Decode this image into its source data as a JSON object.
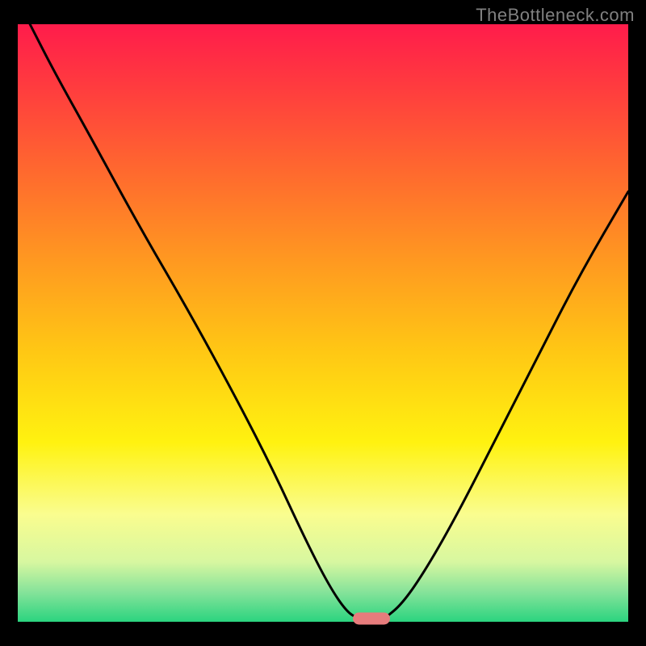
{
  "watermark": "TheBottleneck.com",
  "colors": {
    "bg": "#000000",
    "text_muted": "#808080",
    "curve": "#000000",
    "marker": "#e77c7c",
    "gradient_stops": [
      {
        "offset": 0.0,
        "color": "#ff1c4b"
      },
      {
        "offset": 0.1,
        "color": "#ff3a3f"
      },
      {
        "offset": 0.25,
        "color": "#ff6a2e"
      },
      {
        "offset": 0.4,
        "color": "#ff9a20"
      },
      {
        "offset": 0.55,
        "color": "#ffc814"
      },
      {
        "offset": 0.7,
        "color": "#fff210"
      },
      {
        "offset": 0.82,
        "color": "#fafd8f"
      },
      {
        "offset": 0.9,
        "color": "#d7f7a0"
      },
      {
        "offset": 0.95,
        "color": "#86e39a"
      },
      {
        "offset": 1.0,
        "color": "#2bd47f"
      }
    ]
  },
  "chart_data": {
    "type": "line",
    "title": "",
    "xlabel": "",
    "ylabel": "",
    "xlim": [
      0,
      100
    ],
    "ylim": [
      0,
      100
    ],
    "grid": false,
    "curve_left": [
      {
        "x": 2,
        "y": 100
      },
      {
        "x": 6,
        "y": 92
      },
      {
        "x": 12,
        "y": 81
      },
      {
        "x": 20,
        "y": 66
      },
      {
        "x": 28,
        "y": 52
      },
      {
        "x": 36,
        "y": 37
      },
      {
        "x": 42,
        "y": 25
      },
      {
        "x": 47,
        "y": 14
      },
      {
        "x": 51,
        "y": 6
      },
      {
        "x": 54,
        "y": 1.5
      },
      {
        "x": 56,
        "y": 0.5
      }
    ],
    "curve_right": [
      {
        "x": 60,
        "y": 0.5
      },
      {
        "x": 63,
        "y": 3
      },
      {
        "x": 67,
        "y": 9
      },
      {
        "x": 72,
        "y": 18
      },
      {
        "x": 78,
        "y": 30
      },
      {
        "x": 85,
        "y": 44
      },
      {
        "x": 92,
        "y": 58
      },
      {
        "x": 100,
        "y": 72
      }
    ],
    "minimum_marker": {
      "x": 58,
      "y": 0.5
    }
  }
}
